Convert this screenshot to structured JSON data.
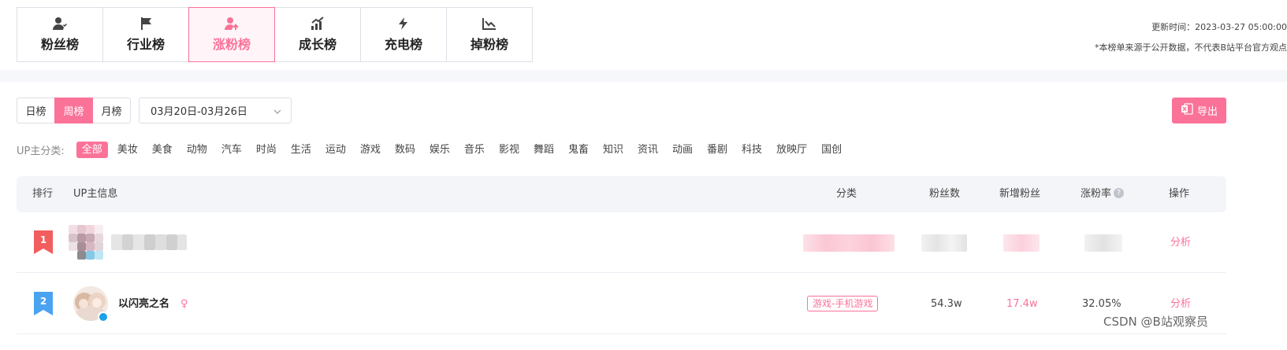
{
  "top_tabs": [
    {
      "label": "粉丝榜",
      "icon": "fan-user-icon"
    },
    {
      "label": "行业榜",
      "icon": "flag-icon"
    },
    {
      "label": "涨粉榜",
      "icon": "user-up-icon"
    },
    {
      "label": "成长榜",
      "icon": "growth-chart-icon"
    },
    {
      "label": "充电榜",
      "icon": "lightning-icon"
    },
    {
      "label": "掉粉榜",
      "icon": "decline-chart-icon"
    }
  ],
  "active_tab": "涨粉榜",
  "meta": {
    "update_time": "更新时间：2023-03-27 05:00:00",
    "disclaimer": "*本榜单来源于公开数据，不代表B站平台官方观点"
  },
  "period": {
    "options": [
      "日榜",
      "周榜",
      "月榜"
    ],
    "selected": "周榜"
  },
  "date_range": "03月20日-03月26日",
  "export_label": "导出",
  "categories": {
    "title": "UP主分类:",
    "items": [
      "全部",
      "美妆",
      "美食",
      "动物",
      "汽车",
      "时尚",
      "生活",
      "运动",
      "游戏",
      "数码",
      "娱乐",
      "音乐",
      "影视",
      "舞蹈",
      "鬼畜",
      "知识",
      "资讯",
      "动画",
      "番剧",
      "科技",
      "放映厅",
      "国创"
    ],
    "selected": "全部"
  },
  "table": {
    "headers": {
      "rank": "排行",
      "info": "UP主信息",
      "category": "分类",
      "fans": "粉丝数",
      "new_fans": "新增粉丝",
      "growth": "涨粉率",
      "action": "操作"
    },
    "rows": [
      {
        "rank": "1",
        "name": "",
        "category": "",
        "fans": "",
        "new_fans": "",
        "growth": "",
        "action": "分析"
      },
      {
        "rank": "2",
        "name": "以闪亮之名",
        "gender": "♀",
        "category": "游戏-手机游戏",
        "fans": "54.3w",
        "new_fans": "17.4w",
        "growth": "32.05%",
        "action": "分析"
      }
    ]
  },
  "watermark": "CSDN @B站观察员",
  "colors": {
    "accent": "#fb7299",
    "rank1": "#f25d5d",
    "rank2": "#4aa3f0",
    "header_bg": "#f4f5f8"
  }
}
